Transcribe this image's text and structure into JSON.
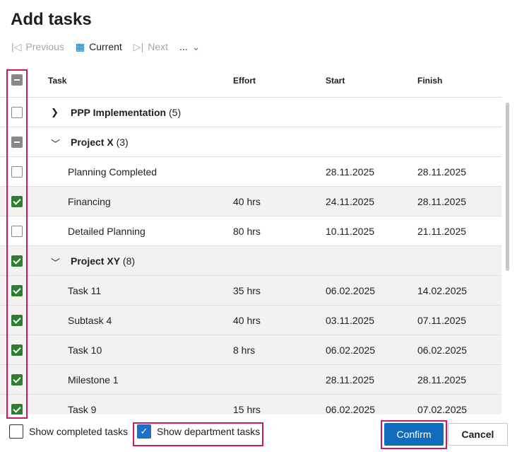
{
  "title": "Add tasks",
  "toolbar": {
    "previous": "Previous",
    "current": "Current",
    "next": "Next",
    "more": "..."
  },
  "columns": {
    "task": "Task",
    "effort": "Effort",
    "start": "Start",
    "finish": "Finish"
  },
  "rows": [
    {
      "type": "group",
      "name": "PPP Implementation",
      "count": "(5)",
      "state": "unchecked",
      "expanded": false
    },
    {
      "type": "group",
      "name": "Project X",
      "count": "(3)",
      "state": "indeterminate",
      "expanded": true
    },
    {
      "type": "task",
      "name": "Planning Completed",
      "effort": "",
      "start": "28.11.2025",
      "finish": "28.11.2025",
      "state": "unchecked"
    },
    {
      "type": "task",
      "name": "Financing",
      "effort": "40 hrs",
      "start": "24.11.2025",
      "finish": "28.11.2025",
      "state": "checked"
    },
    {
      "type": "task",
      "name": "Detailed Planning",
      "effort": "80 hrs",
      "start": "10.11.2025",
      "finish": "21.11.2025",
      "state": "unchecked"
    },
    {
      "type": "group",
      "name": "Project XY",
      "count": "(8)",
      "state": "checked",
      "expanded": true
    },
    {
      "type": "task",
      "name": "Task 11",
      "effort": "35 hrs",
      "start": "06.02.2025",
      "finish": "14.02.2025",
      "state": "checked"
    },
    {
      "type": "task",
      "name": "Subtask 4",
      "effort": "40 hrs",
      "start": "03.11.2025",
      "finish": "07.11.2025",
      "state": "checked"
    },
    {
      "type": "task",
      "name": "Task 10",
      "effort": "8 hrs",
      "start": "06.02.2025",
      "finish": "06.02.2025",
      "state": "checked"
    },
    {
      "type": "task",
      "name": "Milestone 1",
      "effort": "",
      "start": "28.11.2025",
      "finish": "28.11.2025",
      "state": "checked"
    },
    {
      "type": "task",
      "name": "Task 9",
      "effort": "15 hrs",
      "start": "06.02.2025",
      "finish": "07.02.2025",
      "state": "checked"
    }
  ],
  "footer": {
    "show_completed": "Show completed tasks",
    "show_completed_checked": false,
    "show_department": "Show department tasks",
    "show_department_checked": true,
    "confirm": "Confirm",
    "cancel": "Cancel"
  }
}
